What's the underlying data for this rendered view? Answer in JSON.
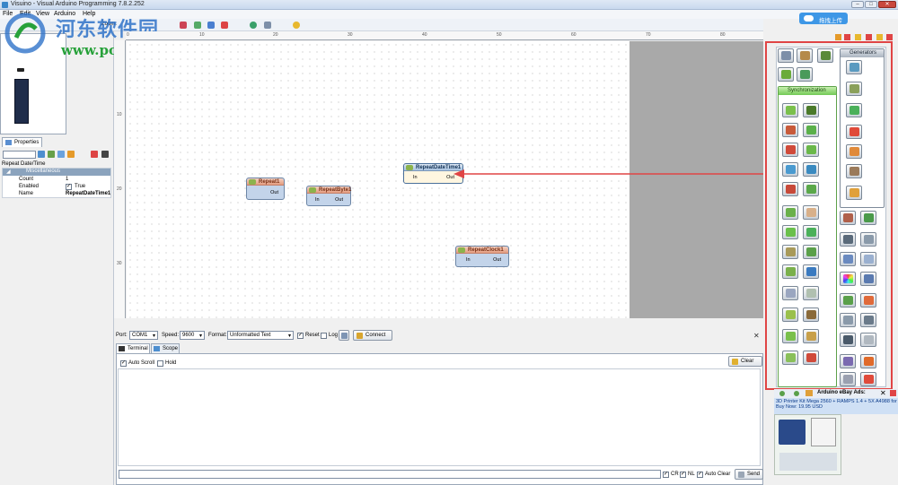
{
  "window": {
    "title": "Visuino - Visual Arduino Programming 7.8.2.252"
  },
  "menu": [
    "File",
    "Edit",
    "View",
    "Arduino",
    "Help"
  ],
  "toolbar": {
    "zoom_label": "Zoom:"
  },
  "watermark": {
    "site_name": "河东软件园",
    "site_url": "www.pc0359.cn"
  },
  "upload_button": "拖拽上传",
  "properties": {
    "tab_label": "Properties",
    "selected_header": "Repeat Date/Time",
    "category": "Miscellaneous",
    "rows": [
      {
        "key": "Count",
        "value": "1"
      },
      {
        "key": "Enabled",
        "value": "True"
      },
      {
        "key": "Name",
        "value": "RepeatDateTime1"
      }
    ]
  },
  "ruler": {
    "top": [
      "0",
      "10",
      "20",
      "30",
      "40",
      "50",
      "60",
      "70",
      "80"
    ],
    "left": [
      "10",
      "20",
      "30"
    ]
  },
  "components": [
    {
      "name": "Repeat1",
      "pins": [
        "Out"
      ]
    },
    {
      "name": "RepeatByte1",
      "pins": [
        "In",
        "Out"
      ]
    },
    {
      "name": "RepeatDateTime1",
      "pins": [
        "In",
        "Out"
      ]
    },
    {
      "name": "RepeatClock1",
      "pins": [
        "In",
        "Out"
      ]
    }
  ],
  "serial": {
    "port_label": "Port:",
    "port_value": "COM1",
    "speed_label": "Speed:",
    "speed_value": "9600",
    "format_label": "Format:",
    "format_value": "Unformatted Text",
    "reset_label": "Reset",
    "log_label": "Log",
    "connect_label": "Connect",
    "tabs": [
      "Terminal",
      "Scope"
    ],
    "auto_scroll_label": "Auto Scroll",
    "hold_label": "Hold",
    "clear_label": "Clear",
    "cr_label": "CR",
    "nl_label": "NL",
    "auto_clear_label": "Auto Clear",
    "send_label": "Send"
  },
  "palette": {
    "group_synchronization": "Synchronization",
    "group_generators": "Generators"
  },
  "ads": {
    "title": "Arduino eBay Ads:",
    "line1": "3D Printer Kit Mega 2560 + RAMPS 1.4 + 5X A4988 for",
    "line2": "Buy Now: 19.95 USD"
  },
  "colors": {
    "highlight": "#e04545",
    "accent": "#3e97e6"
  }
}
